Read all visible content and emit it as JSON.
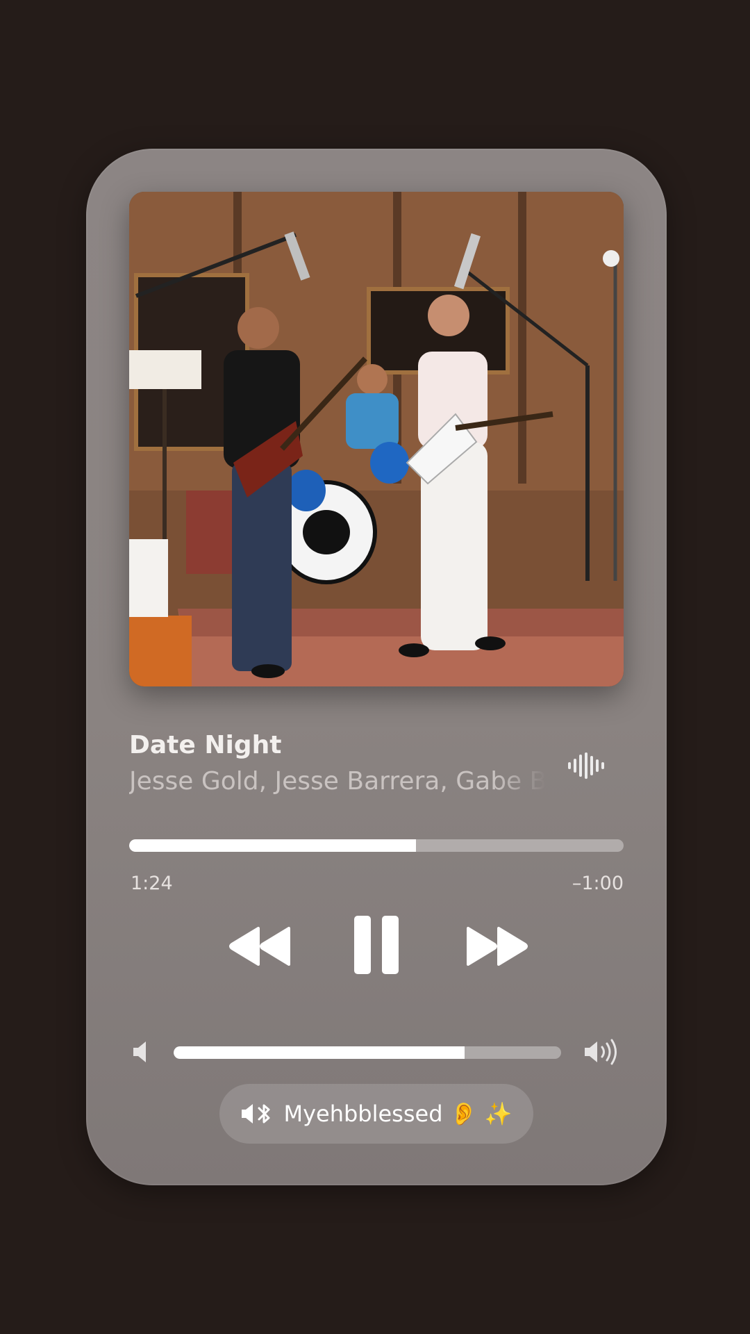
{
  "colors": {
    "background": "#251c19",
    "card": "#8a8381",
    "accent": "#ffffff",
    "secondary_text": "#c9c3c1"
  },
  "now_playing": {
    "title": "Date Night",
    "artist": "Jesse Gold, Jesse Barrera, Gabe B",
    "artwork_icon": "album-artwork-band-in-studio"
  },
  "progress": {
    "elapsed": "1:24",
    "remaining": "–1:00",
    "fraction": 0.58
  },
  "controls": {
    "rewind_icon": "rewind-icon",
    "pause_icon": "pause-icon",
    "forward_icon": "fast-forward-icon",
    "waveform_icon": "waveform-icon"
  },
  "volume": {
    "fraction": 0.75,
    "low_icon": "speaker-low-icon",
    "high_icon": "speaker-high-icon"
  },
  "output_device": {
    "icon": "bluetooth-speaker-icon",
    "name": "Myehbblessed 👂 ✨"
  }
}
